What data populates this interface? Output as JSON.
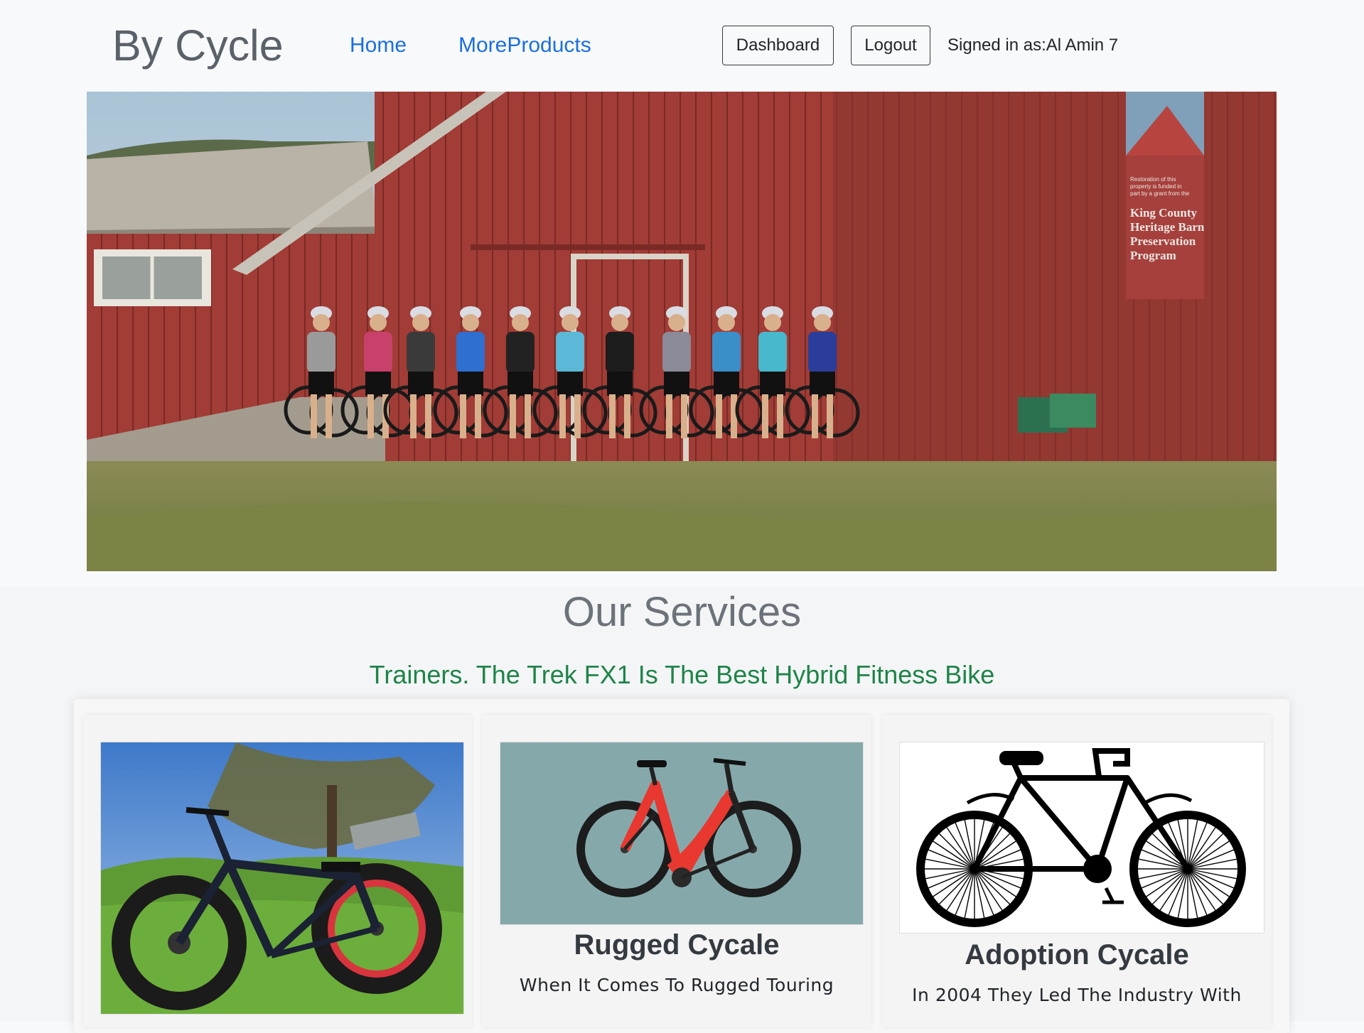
{
  "navbar": {
    "brand": "By Cycle",
    "links": [
      "Home",
      "MoreProducts"
    ],
    "dashboard_label": "Dashboard",
    "logout_label": "Logout",
    "signed_in_text": "Signed in as:Al Amin 7"
  },
  "hero": {
    "barn_sign_lines": [
      "Restoration of this",
      "property is funded in",
      "part by a grant from the",
      "King County",
      "Heritage Barn",
      "Preservation",
      "Program"
    ]
  },
  "services": {
    "title": "Our Services",
    "subtitle": "Trainers. The Trek FX1 Is The Best Hybrid Fitness Bike",
    "cards": [
      {
        "title": "",
        "text": ""
      },
      {
        "title": "Rugged Cycale",
        "text": "When It Comes To Rugged Touring"
      },
      {
        "title": "Adoption Cycale",
        "text": "In 2004 They Led The Industry With"
      }
    ]
  },
  "colors": {
    "brand": "#5a6169",
    "link": "#1a6fe0",
    "subtitle": "#1e8449",
    "barn": "#9e3a35"
  }
}
